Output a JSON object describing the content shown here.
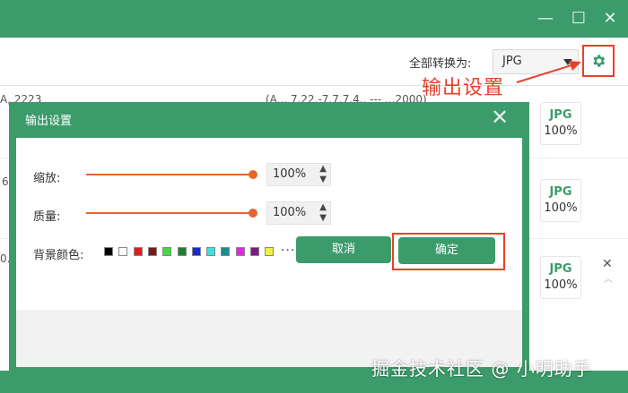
{
  "window": {
    "controls": {
      "minimize": "—",
      "maximize": "☐",
      "close": "✕"
    }
  },
  "toolbar": {
    "convert_all_label": "全部转换为:",
    "format_selected": "JPG",
    "settings_icon": "gear-icon"
  },
  "annotation": {
    "text": "输出设置"
  },
  "rows": [
    {
      "left_text": "A, 2223",
      "mid_text": "(A... 7.22.-7.7.7.4.. --- ...2000)",
      "format": "JPG",
      "quality": "100%"
    },
    {
      "left_text": "6",
      "format": "JPG",
      "quality": "100%"
    },
    {
      "left_text": "0.",
      "format": "JPG",
      "quality": "100%"
    }
  ],
  "row_actions": {
    "close": "✕",
    "up": "︿"
  },
  "dialog": {
    "title": "输出设置",
    "close": "✕",
    "scale": {
      "label": "缩放:",
      "value": "100%",
      "percent": 100
    },
    "quality": {
      "label": "质量:",
      "value": "100%",
      "percent": 100
    },
    "bg_color": {
      "label": "背景颜色:",
      "more": "···"
    },
    "swatches": [
      "#000000",
      "#ffffff",
      "#e41a1c",
      "#7b1a1a",
      "#3fdd3f",
      "#1e7e2e",
      "#1a2ad6",
      "#3ee0e0",
      "#1a8e8e",
      "#e028e0",
      "#7e1a7e",
      "#f0f040"
    ],
    "cancel_label": "取消",
    "ok_label": "确定"
  },
  "watermark": "掘金技术社区 @ 小明助手",
  "colors": {
    "accent": "#3c9b6b",
    "highlight": "#e8412a",
    "slider": "#e8652d"
  }
}
